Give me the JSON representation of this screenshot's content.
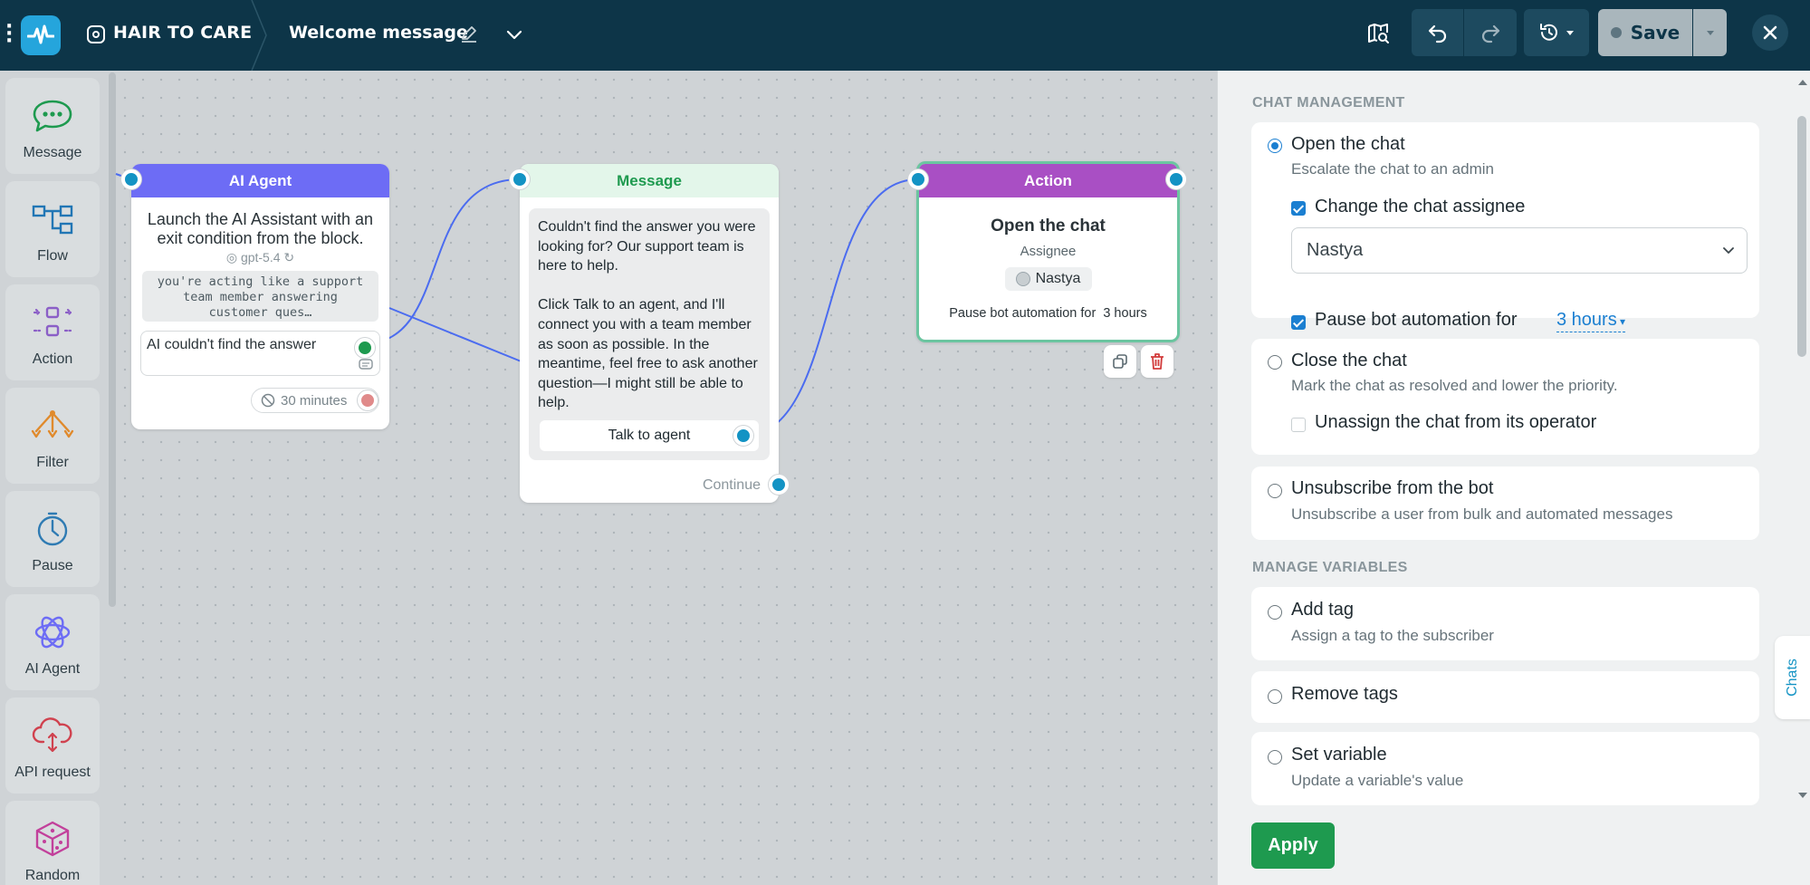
{
  "header": {
    "bot_name": "HAIR TO CARE",
    "flow_name": "Welcome message",
    "save_label": "Save"
  },
  "palette": {
    "items": [
      {
        "label": "Message",
        "icon": "chat-bubble-icon"
      },
      {
        "label": "Flow",
        "icon": "flow-icon"
      },
      {
        "label": "Action",
        "icon": "action-icon"
      },
      {
        "label": "Filter",
        "icon": "filter-icon"
      },
      {
        "label": "Pause",
        "icon": "clock-icon"
      },
      {
        "label": "AI Agent",
        "icon": "ai-agent-icon"
      },
      {
        "label": "API request",
        "icon": "cloud-api-icon"
      },
      {
        "label": "Random",
        "icon": "dice-icon"
      }
    ]
  },
  "nodes": {
    "ai_agent": {
      "title": "AI Agent",
      "description": "Launch the AI Assistant with an exit condition from the block.",
      "model": "gpt-5.4",
      "prompt": "you're acting like a support team member answering customer ques…",
      "condition": "AI couldn't find the answer",
      "timeout": "30 minutes"
    },
    "message": {
      "title": "Message",
      "text": "Couldn't find the answer you were looking for? Our support team is here to help.\n\nClick Talk to an agent, and I'll connect you with a team member as soon as possible. In the meantime, feel free to ask another question—I might still be able to help.",
      "button": "Talk to agent",
      "continue": "Continue"
    },
    "action": {
      "title": "Action",
      "action_name": "Open the chat",
      "assignee_label": "Assignee",
      "assignee": "Nastya",
      "pause_text": "Pause bot automation for  3 hours"
    }
  },
  "panel": {
    "chat_management_title": "CHAT MANAGEMENT",
    "open_chat": {
      "label": "Open the chat",
      "desc": "Escalate the chat to an admin",
      "change_assignee_label": "Change the chat assignee",
      "assignee_value": "Nastya",
      "pause_label": "Pause bot automation for",
      "pause_value": "3 hours"
    },
    "close_chat": {
      "label": "Close the chat",
      "desc": "Mark the chat as resolved and lower the priority.",
      "unassign_label": "Unassign the chat from its operator"
    },
    "unsubscribe": {
      "label": "Unsubscribe from the bot",
      "desc": "Unsubscribe a user from bulk and automated messages"
    },
    "manage_variables_title": "MANAGE VARIABLES",
    "add_tag": {
      "label": "Add tag",
      "desc": "Assign a tag to the subscriber"
    },
    "remove_tags": {
      "label": "Remove tags"
    },
    "set_variable": {
      "label": "Set variable",
      "desc": "Update a variable's value"
    },
    "apply_label": "Apply",
    "chats_tab": "Chats"
  },
  "colors": {
    "topbar": "#0d3548",
    "ai_agent_header": "#6d6cf5",
    "message_header": "#e3f6ea",
    "action_header": "#a94fc4",
    "port": "#1393c4",
    "apply": "#1e9a4f",
    "accent": "#1b7fd1"
  }
}
